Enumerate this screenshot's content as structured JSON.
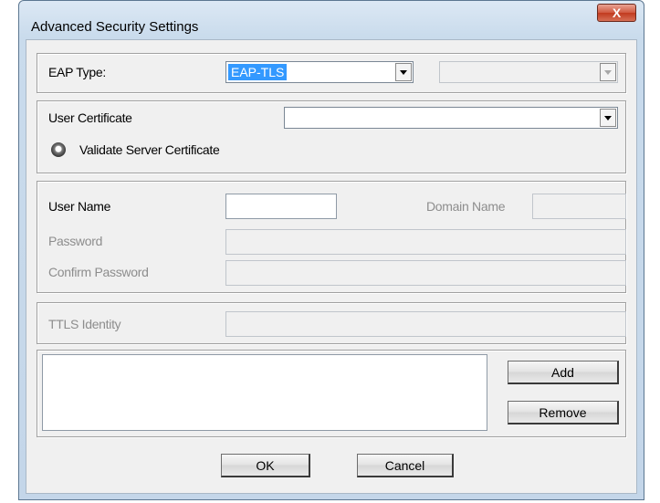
{
  "window": {
    "title": "Advanced Security Settings",
    "close_label": "X"
  },
  "eap": {
    "label": "EAP Type:",
    "selected": "EAP-TLS",
    "secondary_selected": ""
  },
  "certificate": {
    "label": "User Certificate",
    "selected": "",
    "validate_label": "Validate Server Certificate"
  },
  "credentials": {
    "user_name_label": "User Name",
    "user_name_value": "",
    "domain_name_label": "Domain Name",
    "domain_name_value": "",
    "password_label": "Password",
    "password_value": "",
    "confirm_password_label": "Confirm Password",
    "confirm_password_value": ""
  },
  "ttls": {
    "label": "TTLS Identity",
    "value": ""
  },
  "list": {
    "add_label": "Add",
    "remove_label": "Remove"
  },
  "footer": {
    "ok_label": "OK",
    "cancel_label": "Cancel"
  }
}
